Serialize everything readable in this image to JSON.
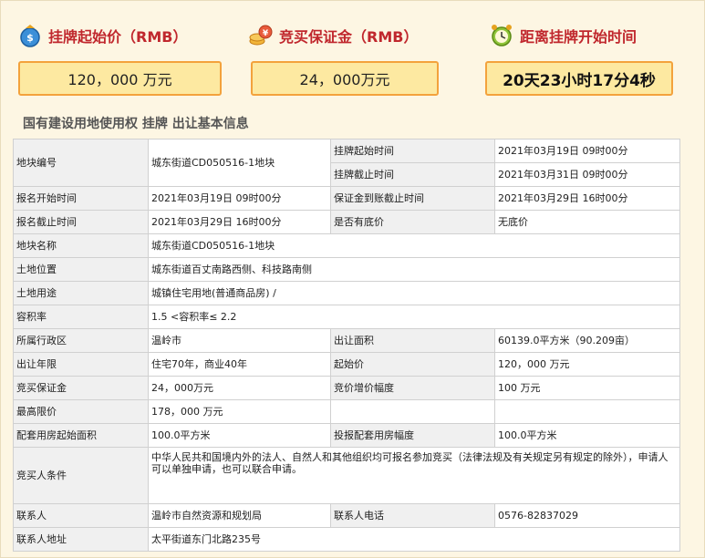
{
  "headers": {
    "start_price_label": "挂牌起始价（RMB）",
    "deposit_label": "竞买保证金（RMB）",
    "countdown_label": "距离挂牌开始时间"
  },
  "summary": {
    "start_price": "120，000 万元",
    "deposit": "24，000万元",
    "countdown": "20天23小时17分4秒"
  },
  "section_title": "国有建设用地使用权 挂牌 出让基本信息",
  "table": {
    "plot_no_label": "地块编号",
    "plot_no": "城东街道CD050516-1地块",
    "listing_start_label": "挂牌起始时间",
    "listing_start": "2021年03月19日 09时00分",
    "listing_end_label": "挂牌截止时间",
    "listing_end": "2021年03月31日 09时00分",
    "signup_start_label": "报名开始时间",
    "signup_start": "2021年03月19日 09时00分",
    "deposit_deadline_label": "保证金到账截止时间",
    "deposit_deadline": "2021年03月29日 16时00分",
    "signup_end_label": "报名截止时间",
    "signup_end": "2021年03月29日 16时00分",
    "reserve_label": "是否有底价",
    "reserve": "无底价",
    "plot_name_label": "地块名称",
    "plot_name": "城东街道CD050516-1地块",
    "location_label": "土地位置",
    "location": "城东街道百丈南路西侧、科技路南侧",
    "usage_label": "土地用途",
    "usage": "城镇住宅用地(普通商品房) /",
    "far_label": "容积率",
    "far": "1.5 <容积率≤ 2.2",
    "district_label": "所属行政区",
    "district": "温岭市",
    "area_label": "出让面积",
    "area": "60139.0平方米（90.209亩）",
    "term_label": "出让年限",
    "term": "住宅70年，商业40年",
    "start_price_label": "起始价",
    "start_price": "120，000 万元",
    "deposit_label": "竞买保证金",
    "deposit": "24，000万元",
    "increment_label": "竞价增价幅度",
    "increment": "100 万元",
    "max_price_label": "最高限价",
    "max_price": "178，000 万元",
    "housing_start_label": "配套用房起始面积",
    "housing_start": "100.0平方米",
    "housing_step_label": "投报配套用房幅度",
    "housing_step": "100.0平方米",
    "conditions_label": "竞买人条件",
    "conditions": "中华人民共和国境内外的法人、自然人和其他组织均可报名参加竞买（法律法规及有关规定另有规定的除外），申请人可以单独申请，也可以联合申请。",
    "contact_label": "联系人",
    "contact": "温岭市自然资源和规划局",
    "phone_label": "联系人电话",
    "phone": "0576-82837029",
    "address_label": "联系人地址",
    "address": "太平街道东门北路235号"
  },
  "icons": {
    "price": "money-bag-icon",
    "deposit": "coins-icon",
    "countdown": "alarm-clock-icon"
  }
}
